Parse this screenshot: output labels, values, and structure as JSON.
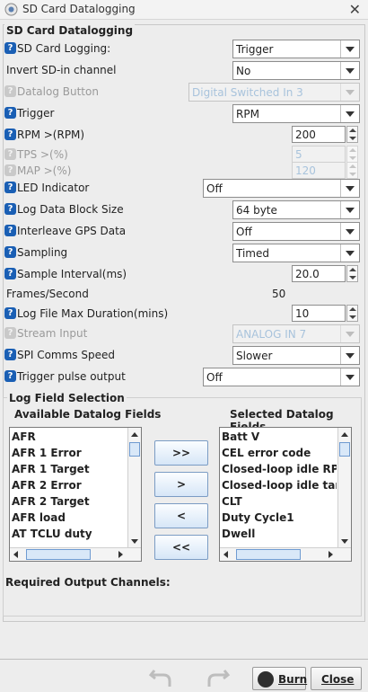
{
  "window": {
    "title": "SD Card Datalogging",
    "close_glyph": "✕"
  },
  "section_title": "SD Card Datalogging",
  "fields": {
    "sd_logging": {
      "label": "SD Card Logging:",
      "value": "Trigger"
    },
    "invert_sd": {
      "label": "Invert SD-in channel",
      "value": "No"
    },
    "datalog_button": {
      "label": "Datalog Button",
      "value": "Digital Switched In 3"
    },
    "trigger": {
      "label": "Trigger",
      "value": "RPM"
    },
    "rpm": {
      "label": "RPM >(RPM)",
      "value": "200"
    },
    "tps": {
      "label": "TPS >(%)",
      "value": "5"
    },
    "map": {
      "label": "MAP >(%)",
      "value": "120"
    },
    "led": {
      "label": "LED Indicator",
      "value": "Off"
    },
    "block_size": {
      "label": "Log Data Block Size",
      "value": "64 byte"
    },
    "gps": {
      "label": "Interleave GPS Data",
      "value": "Off"
    },
    "sampling": {
      "label": "Sampling",
      "value": "Timed"
    },
    "interval": {
      "label": "Sample Interval(ms)",
      "value": "20.0"
    },
    "fps": {
      "label": "Frames/Second",
      "value": "50"
    },
    "max_duration": {
      "label": "Log File Max Duration(mins)",
      "value": "10"
    },
    "stream_input": {
      "label": "Stream Input",
      "value": "ANALOG IN 7"
    },
    "spi_speed": {
      "label": "SPI Comms Speed",
      "value": "Slower"
    },
    "trigger_pulse": {
      "label": "Trigger pulse output",
      "value": "Off"
    }
  },
  "log_selection": {
    "title": "Log Field Selection",
    "available_header": "Available Datalog Fields",
    "selected_header": "Selected Datalog Fields",
    "available": [
      "AFR",
      "AFR 1 Error",
      "AFR 1 Target",
      "AFR 2 Error",
      "AFR 2 Target",
      "AFR load",
      "AT TCLU duty"
    ],
    "selected": [
      "Batt V",
      "CEL error code",
      "Closed-loop idle RPM e",
      "Closed-loop idle target",
      "CLT",
      "Duty Cycle1",
      "Dwell"
    ],
    "buttons": {
      "add_all": ">>",
      "add": ">",
      "remove": "<",
      "remove_all": "<<"
    }
  },
  "required_output_label": "Required Output Channels:",
  "footer": {
    "burn_label": "Burn",
    "close_label": "Close"
  },
  "colors": {
    "help_icon": "#1a5fb4",
    "disabled_text": "#a8c3dc"
  },
  "icons": {
    "help": "help-icon",
    "undo": "undo-icon",
    "redo": "redo-icon",
    "burn": "burn-icon"
  }
}
